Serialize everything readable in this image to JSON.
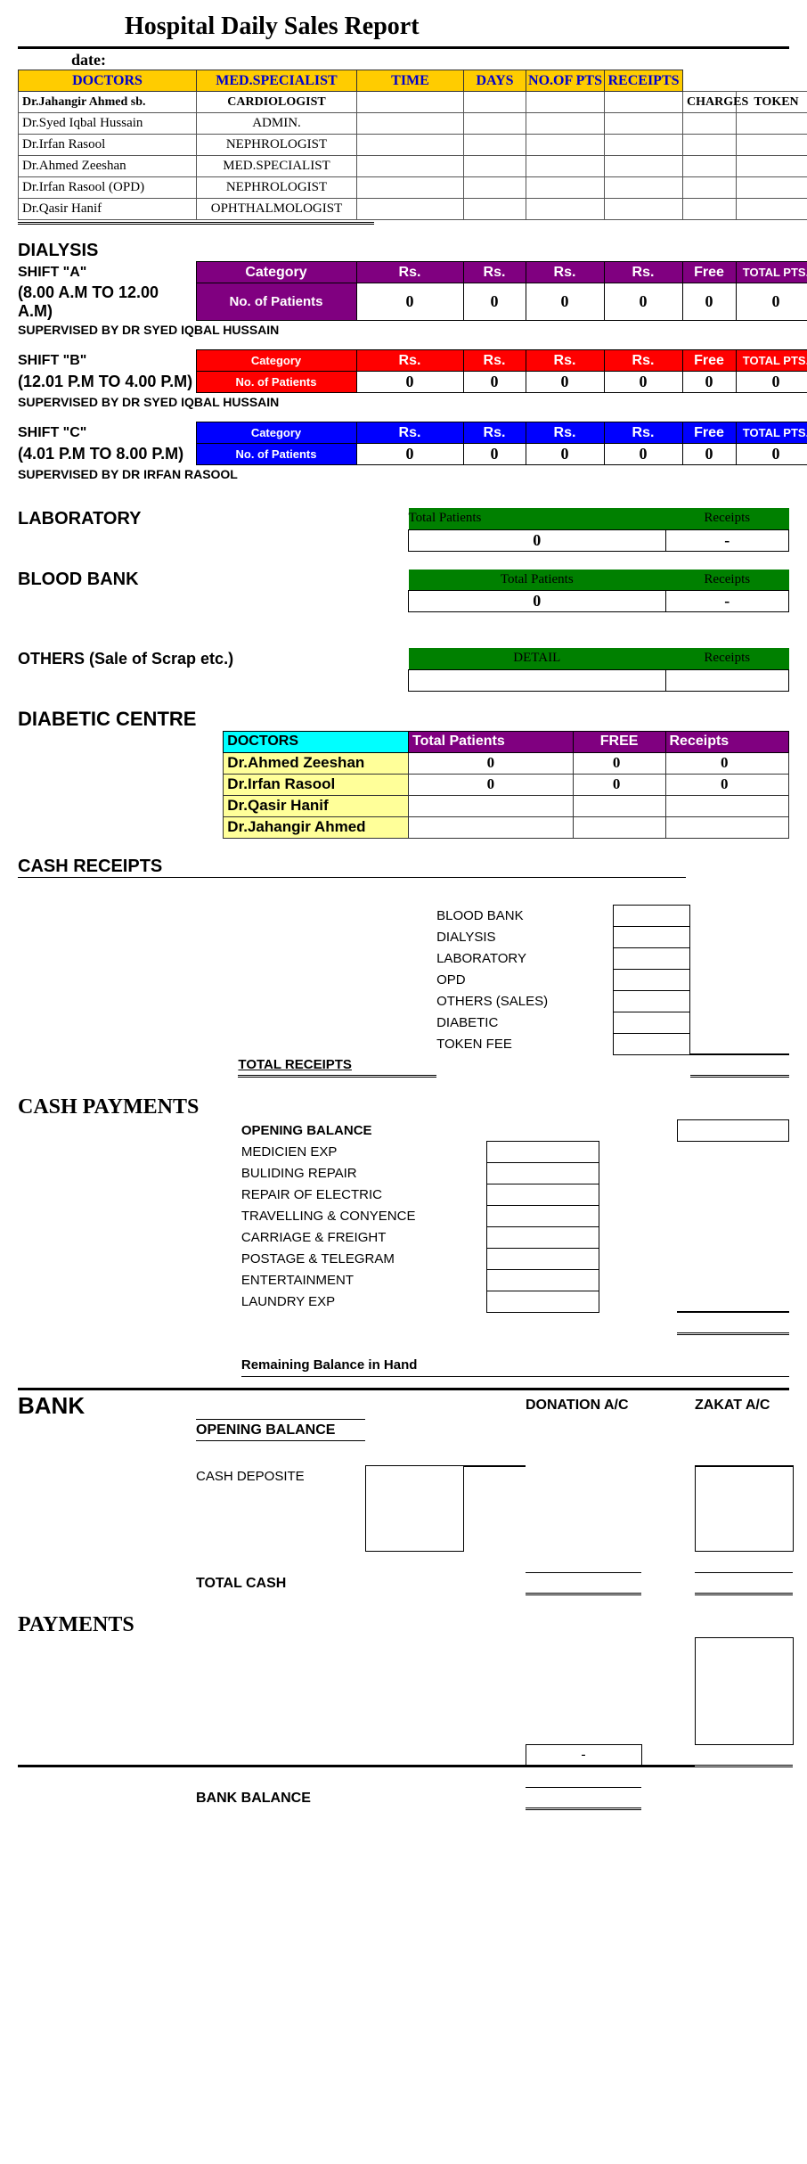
{
  "title": "Hospital Daily Sales Report",
  "date_label": "date:",
  "doctors_table": {
    "headers": [
      "DOCTORS",
      "MED.SPECIALIST",
      "TIME",
      "DAYS",
      "NO.OF PTS",
      "RECEIPTS"
    ],
    "charges": [
      "CHARGES",
      "TOKEN"
    ],
    "rows": [
      {
        "name": "Dr.Jahangir Ahmed sb.",
        "spec": "CARDIOLOGIST"
      },
      {
        "name": "Dr.Syed Iqbal Hussain",
        "spec": "ADMIN."
      },
      {
        "name": "Dr.Irfan Rasool",
        "spec": "NEPHROLOGIST"
      },
      {
        "name": "Dr.Ahmed Zeeshan",
        "spec": "MED.SPECIALIST"
      },
      {
        "name": "Dr.Irfan Rasool (OPD)",
        "spec": "NEPHROLOGIST"
      },
      {
        "name": "Dr.Qasir Hanif",
        "spec": "OPHTHALMOLOGIST"
      }
    ]
  },
  "dialysis": {
    "title": "DIALYSIS",
    "supervised_a": "SUPERVISED BY DR SYED IQBAL HUSSAIN",
    "supervised_b": "SUPERVISED BY DR SYED IQBAL HUSSAIN",
    "supervised_c": "SUPERVISED BY DR IRFAN RASOOL",
    "cat_label": "Category",
    "nop_label": "No. of Patients",
    "cols": [
      "Rs.",
      "Rs.",
      "Rs.",
      "Rs.",
      "Free",
      "TOTAL PTS."
    ],
    "shift_a": {
      "label": "SHIFT \"A\"",
      "time": "(8.00 A.M TO 12.00 A.M)",
      "vals": [
        "0",
        "0",
        "0",
        "0",
        "0",
        "0"
      ]
    },
    "shift_b": {
      "label": "SHIFT \"B\"",
      "time": "(12.01 P.M TO 4.00 P.M)",
      "vals": [
        "0",
        "0",
        "0",
        "0",
        "0",
        "0"
      ]
    },
    "shift_c": {
      "label": "SHIFT \"C\"",
      "time": "(4.01 P.M TO 8.00 P.M)",
      "vals": [
        "0",
        "0",
        "0",
        "0",
        "0",
        "0"
      ]
    }
  },
  "lab": {
    "title": "LABORATORY",
    "hdr1": "Total Patients",
    "hdr2": "Receipts",
    "val1": "0",
    "val2": "-"
  },
  "blood": {
    "title": "BLOOD BANK",
    "hdr1": "Total Patients",
    "hdr2": "Receipts",
    "val1": "0",
    "val2": "-"
  },
  "others": {
    "title": "OTHERS (Sale of Scrap etc.)",
    "hdr1": "DETAIL",
    "hdr2": "Receipts"
  },
  "diabetic": {
    "title": "DIABETIC CENTRE",
    "headers": [
      "DOCTORS",
      "Total Patients",
      "FREE",
      "Receipts"
    ],
    "rows": [
      {
        "name": "Dr.Ahmed Zeeshan",
        "tp": "0",
        "free": "0",
        "rec": "0"
      },
      {
        "name": "Dr.Irfan Rasool",
        "tp": "0",
        "free": "0",
        "rec": "0"
      },
      {
        "name": "Dr.Qasir Hanif",
        "tp": "",
        "free": "",
        "rec": ""
      },
      {
        "name": "Dr.Jahangir Ahmed",
        "tp": "",
        "free": "",
        "rec": ""
      }
    ]
  },
  "cash_receipts": {
    "title": "CASH RECEIPTS",
    "items": [
      "BLOOD BANK",
      "DIALYSIS",
      "LABORATORY",
      "OPD",
      "OTHERS (SALES)",
      "DIABETIC",
      "TOKEN FEE"
    ],
    "total": "TOTAL RECEIPTS"
  },
  "cash_payments": {
    "title": "CASH PAYMENTS",
    "opening": "OPENING BALANCE",
    "items": [
      "MEDICIEN EXP",
      "BULIDING REPAIR",
      "REPAIR OF ELECTRIC",
      "TRAVELLING & CONYENCE",
      "CARRIAGE  & FREIGHT",
      "POSTAGE & TELEGRAM",
      "ENTERTAINMENT",
      "LAUNDRY EXP"
    ],
    "remaining": "Remaining Balance in Hand"
  },
  "bank": {
    "title": "BANK",
    "donation": "DONATION A/C",
    "zakat": "ZAKAT A/C",
    "opening": "OPENING BALANCE",
    "deposit": "CASH DEPOSITE",
    "total": "TOTAL CASH",
    "payments": "PAYMENTS",
    "dash": "-",
    "balance": "BANK BALANCE"
  }
}
